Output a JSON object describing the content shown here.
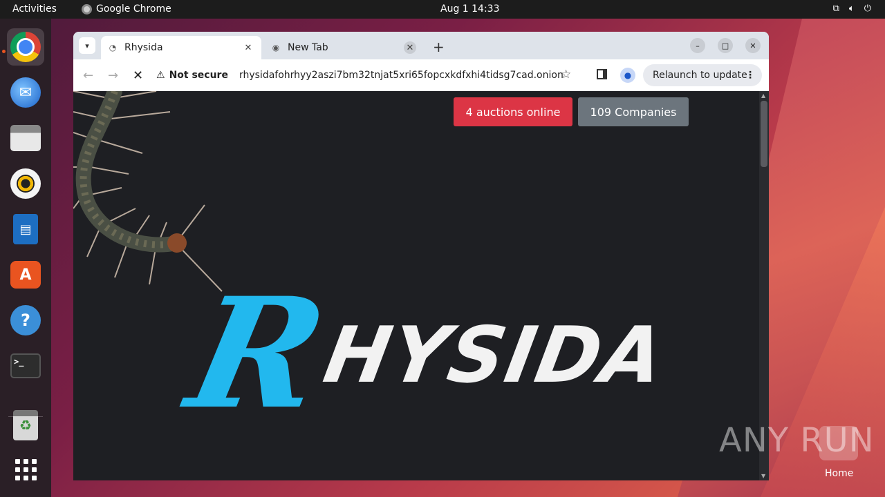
{
  "topbar": {
    "activities": "Activities",
    "app_name": "Google Chrome",
    "clock": "Aug 1  14:33",
    "tray": [
      "network-icon",
      "volume-icon",
      "power-icon"
    ]
  },
  "dock": {
    "items": [
      {
        "name": "chrome",
        "icon": "chrome-icon"
      },
      {
        "name": "thunderbird",
        "icon": "thunderbird-icon"
      },
      {
        "name": "files",
        "icon": "files-icon"
      },
      {
        "name": "rhythmbox",
        "icon": "rhythmbox-icon"
      },
      {
        "name": "writer",
        "icon": "writer-icon"
      },
      {
        "name": "app-center",
        "icon": "store-icon"
      },
      {
        "name": "help",
        "icon": "help-icon"
      },
      {
        "name": "terminal",
        "icon": "terminal-icon"
      },
      {
        "name": "trash",
        "icon": "trash-icon"
      },
      {
        "name": "show-apps",
        "icon": "apps-grid-icon"
      }
    ]
  },
  "browser": {
    "tabs": [
      {
        "title": "Rhysida",
        "active": true
      },
      {
        "title": "New Tab",
        "active": false
      }
    ],
    "security_label": "Not secure",
    "url": "rhysidafohrhyy2aszi7bm32tnjat5xri65fopcxkdfxhi4tidsg7cad.onion",
    "relaunch_label": "Relaunch to update"
  },
  "page": {
    "auctions_button": "4 auctions online",
    "companies_button": "109 Companies",
    "logo_first": "R",
    "logo_rest": "HYSIDA"
  },
  "desktop": {
    "watermark": "ANY RUN",
    "home_label": "Home"
  },
  "colors": {
    "auctions": "#dc3545",
    "companies": "#6c757d",
    "logo_blue": "#22b8ee",
    "page_bg": "#1e1f23"
  }
}
